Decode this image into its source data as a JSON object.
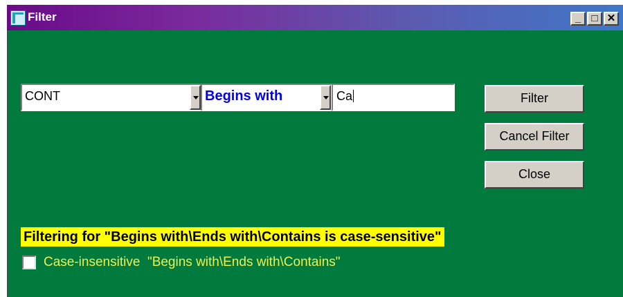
{
  "window": {
    "title": "Filter",
    "controls": {
      "minimize": "_",
      "maximize": "□",
      "close": "✕"
    }
  },
  "filter": {
    "field_value": "CONT",
    "operator_value": "Begins with",
    "search_value": "Ca"
  },
  "buttons": {
    "filter": "Filter",
    "cancel_filter": "Cancel Filter",
    "close": "Close"
  },
  "status": {
    "banner": "Filtering for \"Begins with\\Ends with\\Contains is case-sensitive\""
  },
  "options": {
    "case_insensitive_label": "Case-insensitive  \"Begins with\\Ends with\\Contains\"",
    "case_insensitive_checked": false
  },
  "colors": {
    "client_bg": "#007a3d",
    "banner_bg": "#ffff00",
    "operator_text": "#0000ee",
    "checkbox_label": "#f0f050"
  }
}
